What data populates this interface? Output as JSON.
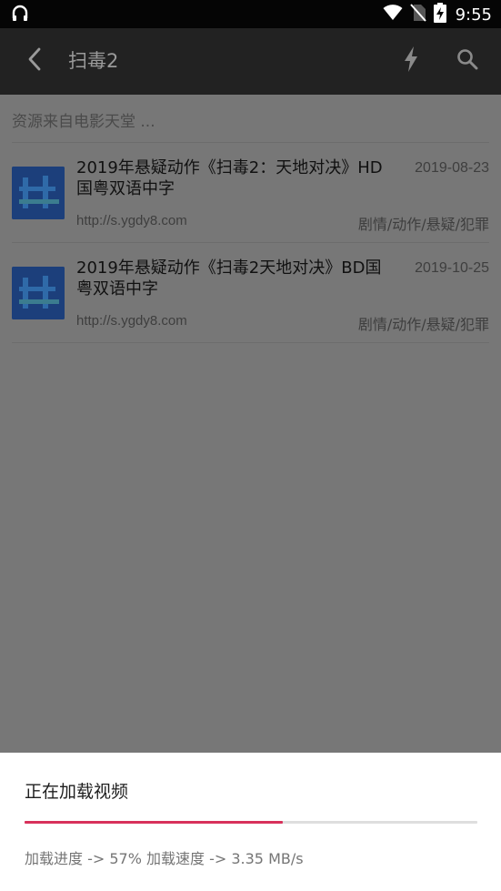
{
  "status_bar": {
    "time": "9:55",
    "left_icon": "headset-notification-icon",
    "right_icons": [
      "wifi-icon",
      "no-sim-icon",
      "battery-charging-icon"
    ]
  },
  "app_bar": {
    "title": "扫毒2",
    "back_icon": "back-arrow-icon",
    "action_icons": [
      "flash-icon",
      "search-icon"
    ]
  },
  "results": {
    "source_note": "资源来自电影天堂 ...",
    "items": [
      {
        "title": "2019年悬疑动作《扫毒2：天地对决》HD国粤双语中字",
        "date": "2019-08-23",
        "url": "http://s.ygdy8.com",
        "tags": "剧情/动作/悬疑/犯罪",
        "thumbnail_icon": "movie-thumbnail-icon"
      },
      {
        "title": "2019年悬疑动作《扫毒2天地对决》BD国粤双语中字",
        "date": "2019-10-25",
        "url": "http://s.ygdy8.com",
        "tags": "剧情/动作/悬疑/犯罪",
        "thumbnail_icon": "movie-thumbnail-icon"
      }
    ]
  },
  "loading_dialog": {
    "title": "正在加载视频",
    "progress_fraction": 0.57,
    "status_text": "加载进度 -> 57% 加载速度 -> 3.35 MB/s",
    "colors": {
      "progress_fill": "#d8315b",
      "progress_track": "#dedede"
    }
  }
}
